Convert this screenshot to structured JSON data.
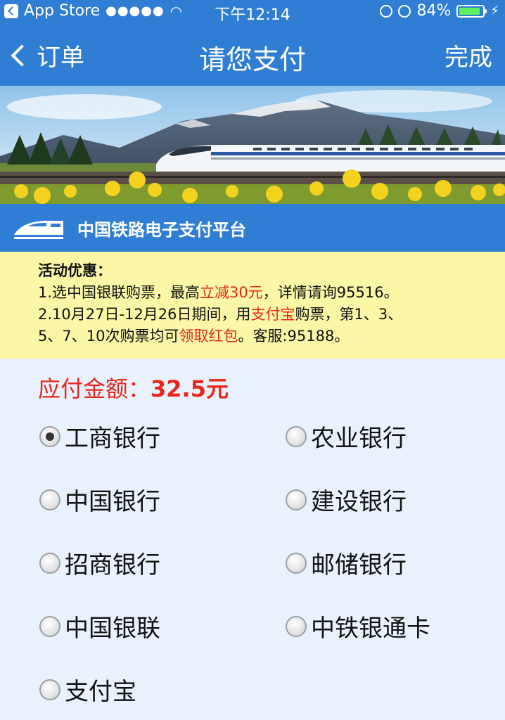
{
  "status_bar": {
    "carrier": "App Store",
    "signal": "●●●●●",
    "time": "下午12:14",
    "battery": "84%"
  },
  "nav": {
    "back_label": "订单",
    "title": "请您支付",
    "done_label": "完成"
  },
  "platform": {
    "title": "中国铁路电子支付平台"
  },
  "promo": {
    "heading": "活动优惠：",
    "line1_a": "1.选中国银联购票，最高",
    "line1_red": "立减30元",
    "line1_b": "，详情请询95516。",
    "line2_a": "2.10月27日-12月26日期间，用",
    "line2_red": "支付宝",
    "line2_b": "购票，第1、3、",
    "line3_a": "5、7、10次购票均可",
    "line3_red": "领取红包",
    "line3_b": "。客服:95188。"
  },
  "amount": {
    "label": "应付金额：",
    "value": "32.5元"
  },
  "banks": [
    {
      "name": "工商银行",
      "selected": true
    },
    {
      "name": "农业银行",
      "selected": false
    },
    {
      "name": "中国银行",
      "selected": false
    },
    {
      "name": "建设银行",
      "selected": false
    },
    {
      "name": "招商银行",
      "selected": false
    },
    {
      "name": "邮储银行",
      "selected": false
    },
    {
      "name": "中国银联",
      "selected": false
    },
    {
      "name": "中铁银通卡",
      "selected": false
    },
    {
      "name": "支付宝",
      "selected": false
    }
  ],
  "colors": {
    "primary": "#2f7ed4",
    "promo_bg": "#fbf7a6",
    "accent_red": "#e8261e"
  }
}
